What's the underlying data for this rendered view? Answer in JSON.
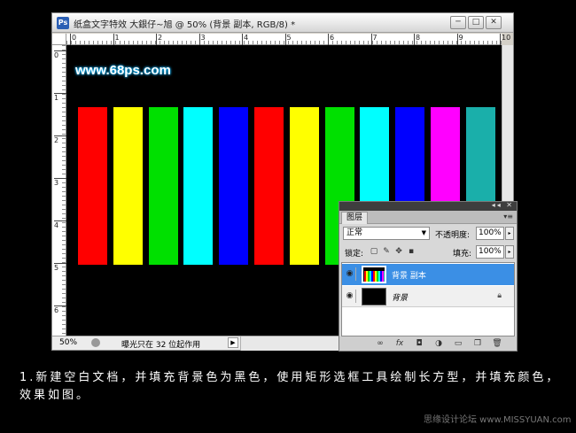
{
  "window": {
    "app_badge": "Ps",
    "title": "纸盒文字特效 大銀仔~旭 @ 50% (背景 副本, RGB/8) *",
    "min": "─",
    "max": "□",
    "close": "✕"
  },
  "rulers": {
    "h": [
      "0",
      "1",
      "2",
      "3",
      "4",
      "5",
      "6",
      "7",
      "8",
      "9",
      "10"
    ],
    "v": [
      "0",
      "1",
      "2",
      "3",
      "4",
      "5",
      "6"
    ]
  },
  "canvas": {
    "watermark": "www.68ps.com",
    "stripe_colors": [
      "#ff0000",
      "#ffff00",
      "#00e000",
      "#00ffff",
      "#0000ff",
      "#ff0000",
      "#ffff00",
      "#00e000",
      "#00ffff",
      "#0000ff",
      "#ff00ff",
      "#1aafaa"
    ]
  },
  "status": {
    "zoom": "50%",
    "message": "曝光只在 32 位起作用",
    "arrow": "▶"
  },
  "layers_panel": {
    "top_buttons": "◂◂ ✕",
    "tab": "图层",
    "menu": "▾≡",
    "blend_mode": "正常",
    "opacity_label": "不透明度:",
    "opacity": "100%",
    "lock_label": "锁定:",
    "fill_label": "填充:",
    "fill": "100%",
    "layers": [
      {
        "name": "背景 副本",
        "selected": true
      },
      {
        "name": "背景",
        "selected": false
      }
    ]
  },
  "caption": "1.新建空白文档，并填充背景色为黑色，使用矩形选框工具绘制长方型，并填充颜色，效果如图。",
  "credit": "思缘设计论坛 www.MISSYUAN.com"
}
